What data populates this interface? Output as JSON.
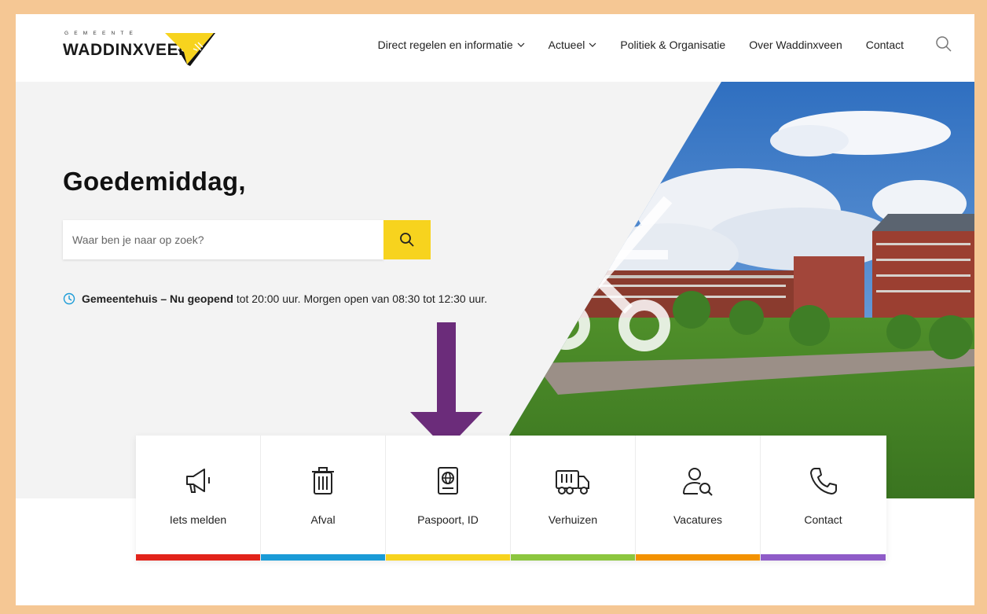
{
  "logo": {
    "small_text": "GEMEENTE",
    "name": "WADDINXVEEN"
  },
  "nav": {
    "items": [
      {
        "label": "Direct regelen en informatie",
        "dropdown": true
      },
      {
        "label": "Actueel",
        "dropdown": true
      },
      {
        "label": "Politiek & Organisatie",
        "dropdown": false
      },
      {
        "label": "Over Waddinxveen",
        "dropdown": false
      },
      {
        "label": "Contact",
        "dropdown": false
      }
    ],
    "search_icon": "search-icon"
  },
  "hero": {
    "greeting": "Goedemiddag,",
    "search": {
      "placeholder": "Waar ben je naar op zoek?",
      "value": ""
    },
    "status": {
      "title": "Gemeentehuis – Nu geopend",
      "text": " tot 20:00 uur. Morgen open van 08:30 tot 12:30 uur."
    }
  },
  "tiles": [
    {
      "label": "Iets melden",
      "icon": "megaphone-icon",
      "color": "#e2231a"
    },
    {
      "label": "Afval",
      "icon": "trash-icon",
      "color": "#1a9bd7"
    },
    {
      "label": "Paspoort, ID",
      "icon": "passport-icon",
      "color": "#f7d31e"
    },
    {
      "label": "Verhuizen",
      "icon": "moving-truck-icon",
      "color": "#8cc63f"
    },
    {
      "label": "Vacatures",
      "icon": "person-search-icon",
      "color": "#f39200"
    },
    {
      "label": "Contact",
      "icon": "phone-icon",
      "color": "#8f5cc8"
    }
  ],
  "colors": {
    "accent_yellow": "#f7d31e",
    "frame": "#f5c794",
    "arrow": "#6b2c7a"
  }
}
